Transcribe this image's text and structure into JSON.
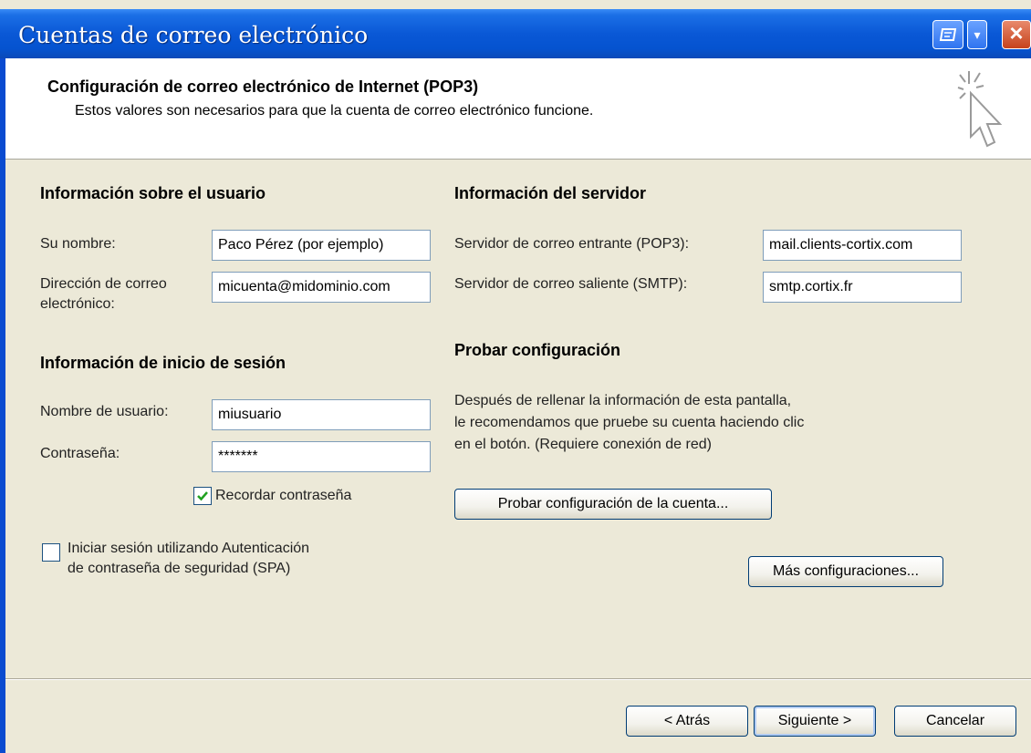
{
  "window": {
    "title": "Cuentas de correo electrónico"
  },
  "header": {
    "title": "Configuración de correo electrónico de Internet (POP3)",
    "subtitle": "Estos valores son necesarios para que la cuenta de correo electrónico funcione."
  },
  "user_info": {
    "heading": "Información sobre el usuario",
    "name_label": "Su nombre:",
    "name_value": "Paco Pérez (por ejemplo)",
    "email_label_line1": "Dirección de correo",
    "email_label_line2": "electrónico:",
    "email_value": "micuenta@midominio.com"
  },
  "login_info": {
    "heading": "Información de inicio de sesión",
    "username_label": "Nombre de usuario:",
    "username_value": "miusuario",
    "password_label": "Contraseña:",
    "password_value": "*******",
    "remember_label": "Recordar contraseña",
    "remember_checked": true,
    "spa_label_line1": "Iniciar sesión utilizando Autenticación",
    "spa_label_line2": "de contraseña de seguridad (SPA)",
    "spa_checked": false
  },
  "server_info": {
    "heading": "Información del servidor",
    "incoming_label": "Servidor de correo entrante (POP3):",
    "incoming_value": "mail.clients-cortix.com",
    "outgoing_label": "Servidor de correo saliente (SMTP):",
    "outgoing_value": "smtp.cortix.fr"
  },
  "test": {
    "heading": "Probar configuración",
    "line1": "Después de rellenar la información de esta pantalla,",
    "line2": "le recomendamos que pruebe su cuenta haciendo clic",
    "line3": "en el botón. (Requiere conexión de red)",
    "test_button": "Probar configuración de la cuenta...",
    "more_button": "Más configuraciones..."
  },
  "footer": {
    "back": "< Atrás",
    "next": "Siguiente >",
    "cancel": "Cancelar"
  },
  "colors": {
    "titlebar": "#0553d0",
    "dialog_bg": "#ece9d8",
    "checkmark": "#21a121"
  }
}
